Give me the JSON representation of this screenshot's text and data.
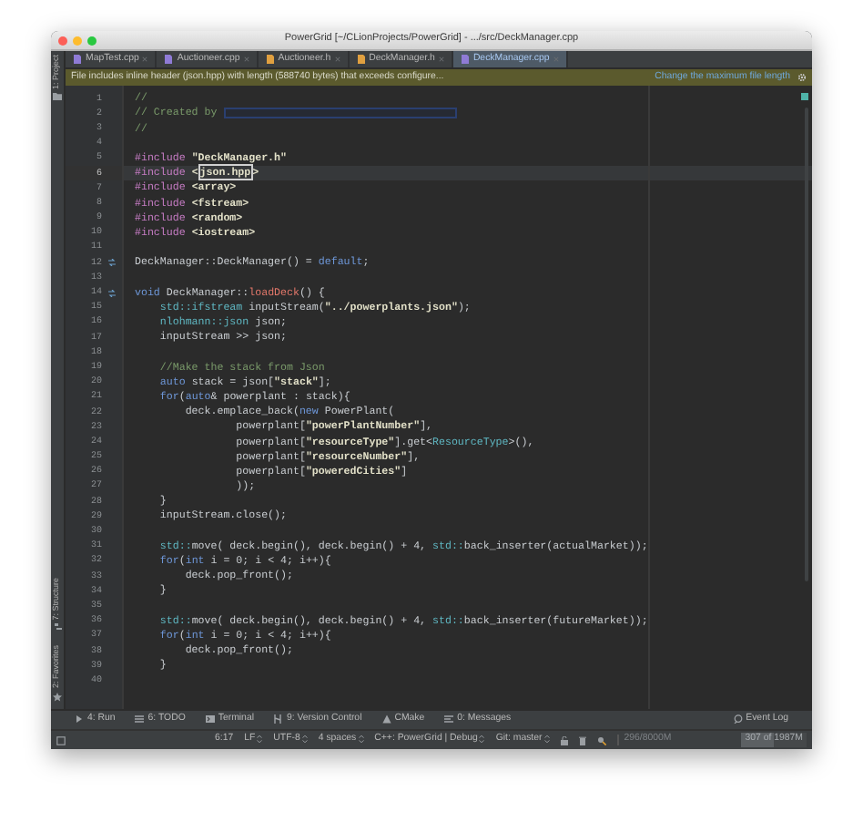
{
  "window": {
    "title": "PowerGrid [~/CLionProjects/PowerGrid] - .../src/DeckManager.cpp"
  },
  "tabs": [
    {
      "label": "MapTest.cpp",
      "kind": "source",
      "selected": false
    },
    {
      "label": "Auctioneer.cpp",
      "kind": "source",
      "selected": false
    },
    {
      "label": "Auctioneer.h",
      "kind": "header",
      "selected": false
    },
    {
      "label": "DeckManager.h",
      "kind": "header",
      "selected": false
    },
    {
      "label": "DeckManager.cpp",
      "kind": "source",
      "selected": true
    }
  ],
  "side_tools": [
    "1: Project",
    "7: Structure",
    "2: Favorites"
  ],
  "banner": {
    "message": "File includes inline header (json.hpp) with length (588740 bytes) that exceeds configure...",
    "link": "Change the maximum file length"
  },
  "editor": {
    "lines": [
      {
        "number": "1",
        "tokens": [
          {
            "text": "//",
            "kind": "comment"
          }
        ]
      },
      {
        "number": "2",
        "redacted": true,
        "tokens": [
          {
            "text": "// Created by ",
            "kind": "comment"
          }
        ]
      },
      {
        "number": "3",
        "tokens": [
          {
            "text": "//",
            "kind": "comment"
          }
        ]
      },
      {
        "number": "4"
      },
      {
        "number": "5",
        "tokens": [
          {
            "text": "#include ",
            "kind": "preproc"
          },
          {
            "text": "\"DeckManager.h\"",
            "kind": "string"
          }
        ]
      },
      {
        "number": "6",
        "current": true,
        "tokens": [
          {
            "text": "#include ",
            "kind": "preproc"
          },
          {
            "text": "<",
            "kind": "string"
          },
          {
            "text": "json.hpp",
            "kind": "match"
          },
          {
            "text": ">",
            "kind": "string"
          }
        ]
      },
      {
        "number": "7",
        "tokens": [
          {
            "text": "#include ",
            "kind": "preproc"
          },
          {
            "text": "<array>",
            "kind": "string"
          }
        ]
      },
      {
        "number": "8",
        "tokens": [
          {
            "text": "#include ",
            "kind": "preproc"
          },
          {
            "text": "<fstream>",
            "kind": "string"
          }
        ]
      },
      {
        "number": "9",
        "tokens": [
          {
            "text": "#include ",
            "kind": "preproc"
          },
          {
            "text": "<random>",
            "kind": "string"
          }
        ]
      },
      {
        "number": "10",
        "tokens": [
          {
            "text": "#include ",
            "kind": "preproc"
          },
          {
            "text": "<iostream>",
            "kind": "string"
          }
        ]
      },
      {
        "number": "11"
      },
      {
        "number": "12",
        "override": true,
        "tokens": [
          {
            "text": "DeckManager::DeckManager() = ",
            "kind": "plain"
          },
          {
            "text": "default",
            "kind": "keyword"
          },
          {
            "text": ";",
            "kind": "plain"
          }
        ]
      },
      {
        "number": "13"
      },
      {
        "number": "14",
        "override": true,
        "tokens": [
          {
            "text": "void ",
            "kind": "keyword"
          },
          {
            "text": "DeckManager::",
            "kind": "plain"
          },
          {
            "text": "loadDeck",
            "kind": "function"
          },
          {
            "text": "() {",
            "kind": "plain"
          }
        ]
      },
      {
        "number": "15",
        "tokens": [
          {
            "text": "    std::ifstream ",
            "kind": "type"
          },
          {
            "text": "inputStream(",
            "kind": "plain"
          },
          {
            "text": "\"../powerplants.json\"",
            "kind": "string"
          },
          {
            "text": ");",
            "kind": "plain"
          }
        ]
      },
      {
        "number": "16",
        "tokens": [
          {
            "text": "    nlohmann::json ",
            "kind": "type"
          },
          {
            "text": "json;",
            "kind": "plain"
          }
        ]
      },
      {
        "number": "17",
        "tokens": [
          {
            "text": "    inputStream >> json;",
            "kind": "plain"
          }
        ]
      },
      {
        "number": "18"
      },
      {
        "number": "19",
        "tokens": [
          {
            "text": "    //Make the stack from Json",
            "kind": "comment"
          }
        ]
      },
      {
        "number": "20",
        "tokens": [
          {
            "text": "    auto ",
            "kind": "keyword"
          },
          {
            "text": "stack = json[",
            "kind": "plain"
          },
          {
            "text": "\"stack\"",
            "kind": "string"
          },
          {
            "text": "];",
            "kind": "plain"
          }
        ]
      },
      {
        "number": "21",
        "tokens": [
          {
            "text": "    for",
            "kind": "keyword"
          },
          {
            "text": "(",
            "kind": "plain"
          },
          {
            "text": "auto",
            "kind": "keyword"
          },
          {
            "text": "& powerplant : stack){",
            "kind": "plain"
          }
        ]
      },
      {
        "number": "22",
        "tokens": [
          {
            "text": "        deck.emplace_back(",
            "kind": "plain"
          },
          {
            "text": "new ",
            "kind": "keyword"
          },
          {
            "text": "PowerPlant(",
            "kind": "plain"
          }
        ]
      },
      {
        "number": "23",
        "tokens": [
          {
            "text": "                powerplant[",
            "kind": "plain"
          },
          {
            "text": "\"powerPlantNumber\"",
            "kind": "string"
          },
          {
            "text": "],",
            "kind": "plain"
          }
        ]
      },
      {
        "number": "24",
        "tokens": [
          {
            "text": "                powerplant[",
            "kind": "plain"
          },
          {
            "text": "\"resourceType\"",
            "kind": "string"
          },
          {
            "text": "].get<",
            "kind": "plain"
          },
          {
            "text": "ResourceType",
            "kind": "type"
          },
          {
            "text": ">(),",
            "kind": "plain"
          }
        ]
      },
      {
        "number": "25",
        "tokens": [
          {
            "text": "                powerplant[",
            "kind": "plain"
          },
          {
            "text": "\"resourceNumber\"",
            "kind": "string"
          },
          {
            "text": "],",
            "kind": "plain"
          }
        ]
      },
      {
        "number": "26",
        "tokens": [
          {
            "text": "                powerplant[",
            "kind": "plain"
          },
          {
            "text": "\"poweredCities\"",
            "kind": "string"
          },
          {
            "text": "]",
            "kind": "plain"
          }
        ]
      },
      {
        "number": "27",
        "tokens": [
          {
            "text": "                ));",
            "kind": "plain"
          }
        ]
      },
      {
        "number": "28",
        "tokens": [
          {
            "text": "    }",
            "kind": "plain"
          }
        ]
      },
      {
        "number": "29",
        "tokens": [
          {
            "text": "    inputStream.close();",
            "kind": "plain"
          }
        ]
      },
      {
        "number": "30"
      },
      {
        "number": "31",
        "tokens": [
          {
            "text": "    std::",
            "kind": "type"
          },
          {
            "text": "move( deck.begin(), deck.begin() + 4, ",
            "kind": "plain"
          },
          {
            "text": "std::",
            "kind": "type"
          },
          {
            "text": "back_inserter(actualMarket));",
            "kind": "plain"
          }
        ]
      },
      {
        "number": "32",
        "tokens": [
          {
            "text": "    for",
            "kind": "keyword"
          },
          {
            "text": "(",
            "kind": "plain"
          },
          {
            "text": "int ",
            "kind": "keyword"
          },
          {
            "text": "i = 0; i < 4; i++){",
            "kind": "plain"
          }
        ]
      },
      {
        "number": "33",
        "tokens": [
          {
            "text": "        deck.pop_front();",
            "kind": "plain"
          }
        ]
      },
      {
        "number": "34",
        "tokens": [
          {
            "text": "    }",
            "kind": "plain"
          }
        ]
      },
      {
        "number": "35"
      },
      {
        "number": "36",
        "tokens": [
          {
            "text": "    std::",
            "kind": "type"
          },
          {
            "text": "move( deck.begin(), deck.begin() + 4, ",
            "kind": "plain"
          },
          {
            "text": "std::",
            "kind": "type"
          },
          {
            "text": "back_inserter(futureMarket));",
            "kind": "plain"
          }
        ]
      },
      {
        "number": "37",
        "tokens": [
          {
            "text": "    for",
            "kind": "keyword"
          },
          {
            "text": "(",
            "kind": "plain"
          },
          {
            "text": "int ",
            "kind": "keyword"
          },
          {
            "text": "i = 0; i < 4; i++){",
            "kind": "plain"
          }
        ]
      },
      {
        "number": "38",
        "tokens": [
          {
            "text": "        deck.pop_front();",
            "kind": "plain"
          }
        ]
      },
      {
        "number": "39",
        "tokens": [
          {
            "text": "    }",
            "kind": "plain"
          }
        ]
      },
      {
        "number": "40"
      }
    ]
  },
  "tool_buttons": [
    {
      "label": "4: Run",
      "kind": "run"
    },
    {
      "label": "6: TODO",
      "kind": "todo"
    },
    {
      "label": "Terminal",
      "kind": "terminal"
    },
    {
      "label": "9: Version Control",
      "kind": "vcs"
    },
    {
      "label": "CMake",
      "kind": "cmake"
    },
    {
      "label": "0: Messages",
      "kind": "messages"
    }
  ],
  "event_log": "Event Log",
  "status_bar": {
    "items": [
      {
        "label": "6:17",
        "dropdown": false
      },
      {
        "label": "LF",
        "dropdown": true
      },
      {
        "label": "UTF-8",
        "dropdown": true
      },
      {
        "label": "4 spaces",
        "dropdown": true
      },
      {
        "label": "C++: PowerGrid | Debug",
        "dropdown": true
      },
      {
        "label": "Git: master",
        "dropdown": true
      }
    ],
    "memory": "296/8000M",
    "heap": {
      "label": "307 of 1987M",
      "level": 0.5
    }
  }
}
